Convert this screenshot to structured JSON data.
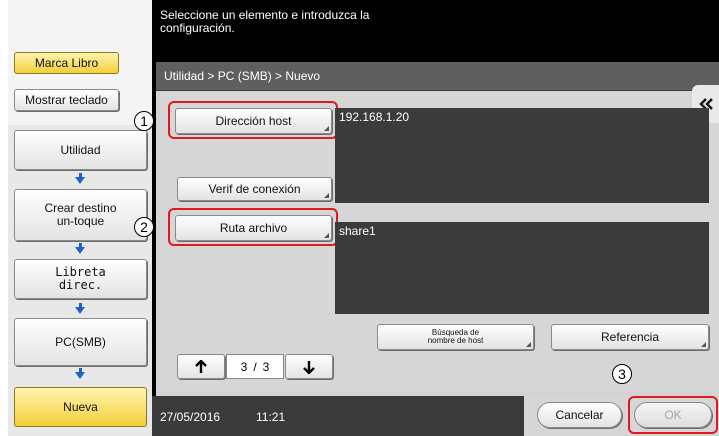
{
  "header": {
    "instruction_line1": "Seleccione un elemento e introduzca la",
    "instruction_line2": "configuración."
  },
  "sidebar": {
    "bookmark_label": "Marca Libro",
    "show_keyboard_label": "Mostrar teclado",
    "steps": [
      {
        "line1": "Utilidad",
        "line2": ""
      },
      {
        "line1": "Crear destino",
        "line2": "un-toque"
      },
      {
        "line1": "Libreta",
        "line2": "direc."
      },
      {
        "line1": "PC(SMB)",
        "line2": ""
      },
      {
        "line1": "Nueva",
        "line2": ""
      }
    ]
  },
  "breadcrumb": "Utilidad > PC (SMB) > Nuevo",
  "form": {
    "host_address_label": "Dirección host",
    "host_address_value": "192.168.1.20",
    "check_connection_label": "Verif de conexión",
    "file_path_label": "Ruta archivo",
    "file_path_value": "share1",
    "host_search_line1": "Búsqueda de",
    "host_search_line2": "nombre de host",
    "reference_label": "Referencia"
  },
  "pager": {
    "current": "3",
    "separator": "/",
    "total": "3"
  },
  "footer": {
    "date": "27/05/2016",
    "time": "11:21",
    "cancel_label": "Cancelar",
    "ok_label": "OK"
  },
  "annotations": {
    "callout_1": "1",
    "callout_2": "2",
    "callout_3": "3",
    "highlight_color": "#e0191c"
  },
  "colors": {
    "active_yellow": "#f4cf3a",
    "flow_arrow_blue": "#1e63c8"
  }
}
